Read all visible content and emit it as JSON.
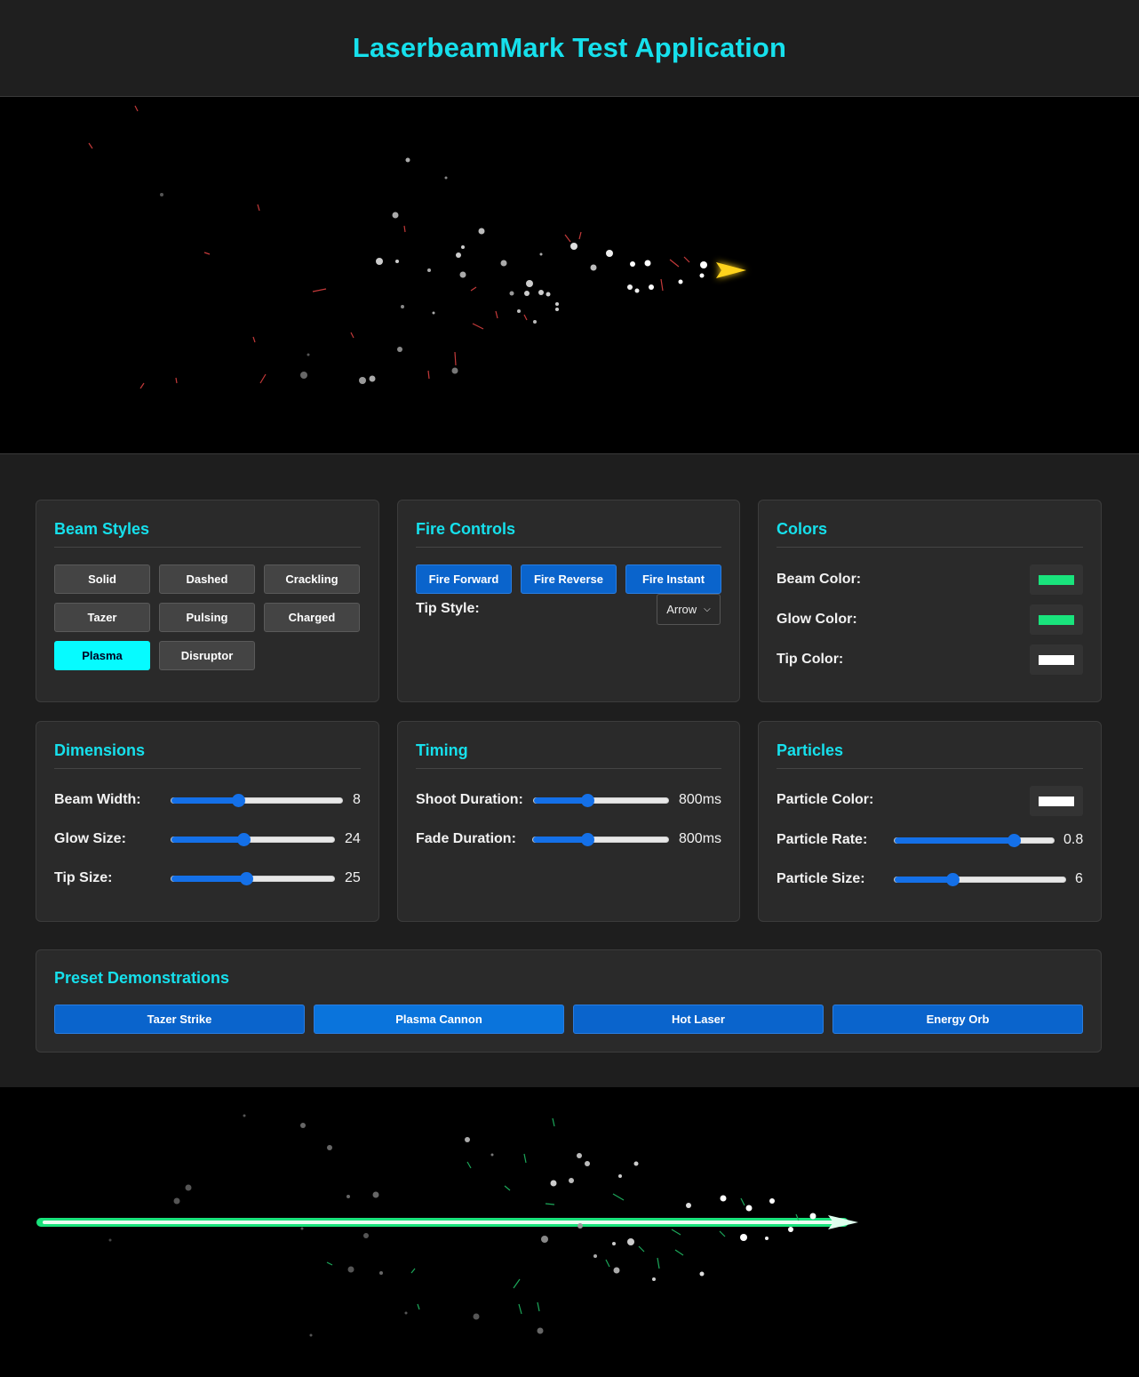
{
  "app": {
    "title": "LaserbeamMark Test Application"
  },
  "beam_styles": {
    "title": "Beam Styles",
    "buttons": [
      "Solid",
      "Dashed",
      "Crackling",
      "Tazer",
      "Pulsing",
      "Charged",
      "Plasma",
      "Disruptor"
    ],
    "active": "Plasma"
  },
  "fire_controls": {
    "title": "Fire Controls",
    "fire_forward": "Fire Forward",
    "fire_reverse": "Fire Reverse",
    "fire_instant": "Fire Instant",
    "tip_style_label": "Tip Style:",
    "tip_style_value": "Arrow"
  },
  "colors": {
    "title": "Colors",
    "beam_label": "Beam Color:",
    "beam_color": "#19e37c",
    "glow_label": "Glow Color:",
    "glow_color": "#19e37c",
    "tip_label": "Tip Color:",
    "tip_color": "#ffffff"
  },
  "dimensions": {
    "title": "Dimensions",
    "beam_width_label": "Beam Width:",
    "beam_width": "8",
    "beam_width_fraction": 0.39,
    "glow_size_label": "Glow Size:",
    "glow_size": "24",
    "glow_size_fraction": 0.44,
    "tip_size_label": "Tip Size:",
    "tip_size": "25",
    "tip_size_fraction": 0.46
  },
  "timing": {
    "title": "Timing",
    "shoot_label": "Shoot Duration:",
    "shoot_value": "800ms",
    "shoot_fraction": 0.4,
    "fade_label": "Fade Duration:",
    "fade_value": "800ms",
    "fade_fraction": 0.4
  },
  "particles": {
    "title": "Particles",
    "color_label": "Particle Color:",
    "color": "#ffffff",
    "rate_label": "Particle Rate:",
    "rate_value": "0.8",
    "rate_fraction": 0.75,
    "size_label": "Particle Size:",
    "size_value": "6",
    "size_fraction": 0.34
  },
  "presets": {
    "title": "Preset Demonstrations",
    "buttons": [
      "Tazer Strike",
      "Plasma Cannon",
      "Hot Laser",
      "Energy Orb"
    ]
  },
  "colors_theme": {
    "accent": "#16e0ec",
    "primary_button": "#0a64cc",
    "active_style": "#06fbff",
    "demo_beam_red": "#ff4040",
    "demo_beam_green": "#19e37c"
  }
}
